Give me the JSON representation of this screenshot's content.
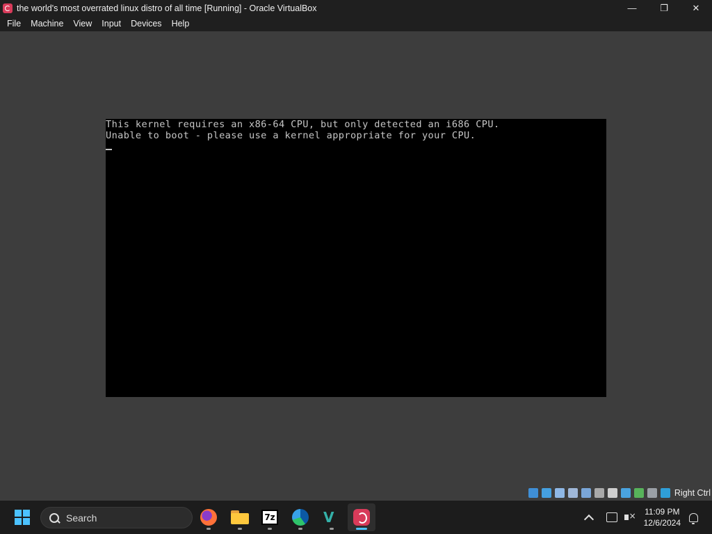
{
  "window": {
    "title": "the world's most overrated linux distro of all time [Running] - Oracle VirtualBox",
    "controls": {
      "minimize": "—",
      "maximize": "❐",
      "close": "✕"
    }
  },
  "menu": {
    "items": [
      "File",
      "Machine",
      "View",
      "Input",
      "Devices",
      "Help"
    ]
  },
  "console": {
    "lines": [
      "This kernel requires an x86-64 CPU, but only detected an i686 CPU.",
      "Unable to boot - please use a kernel appropriate for your CPU."
    ]
  },
  "statusbar": {
    "host_key": "Right Ctrl",
    "icon_colors": [
      "#3f8fd6",
      "#45a0e0",
      "#8fb8e6",
      "#9fb7d8",
      "#7aa6d8",
      "#a9a9a9",
      "#cfcfcf",
      "#4aa3df",
      "#57b35a",
      "#9aa0a6",
      "#2f9fd8"
    ]
  },
  "taskbar": {
    "search_placeholder": "Search",
    "apps": [
      "Firefox",
      "File Explorer",
      "7-Zip",
      "Microsoft Edge",
      "VirtualBox",
      "Oracle VM Window"
    ],
    "sevenzip_label": "7z",
    "vbox_label": "V",
    "clock_time": "11:09 PM",
    "clock_date": "12/6/2024"
  },
  "colors": {
    "taskbar_accent": "#4cc2ff",
    "console_text": "#c6c6c6",
    "debian_red": "#d83b5a"
  }
}
